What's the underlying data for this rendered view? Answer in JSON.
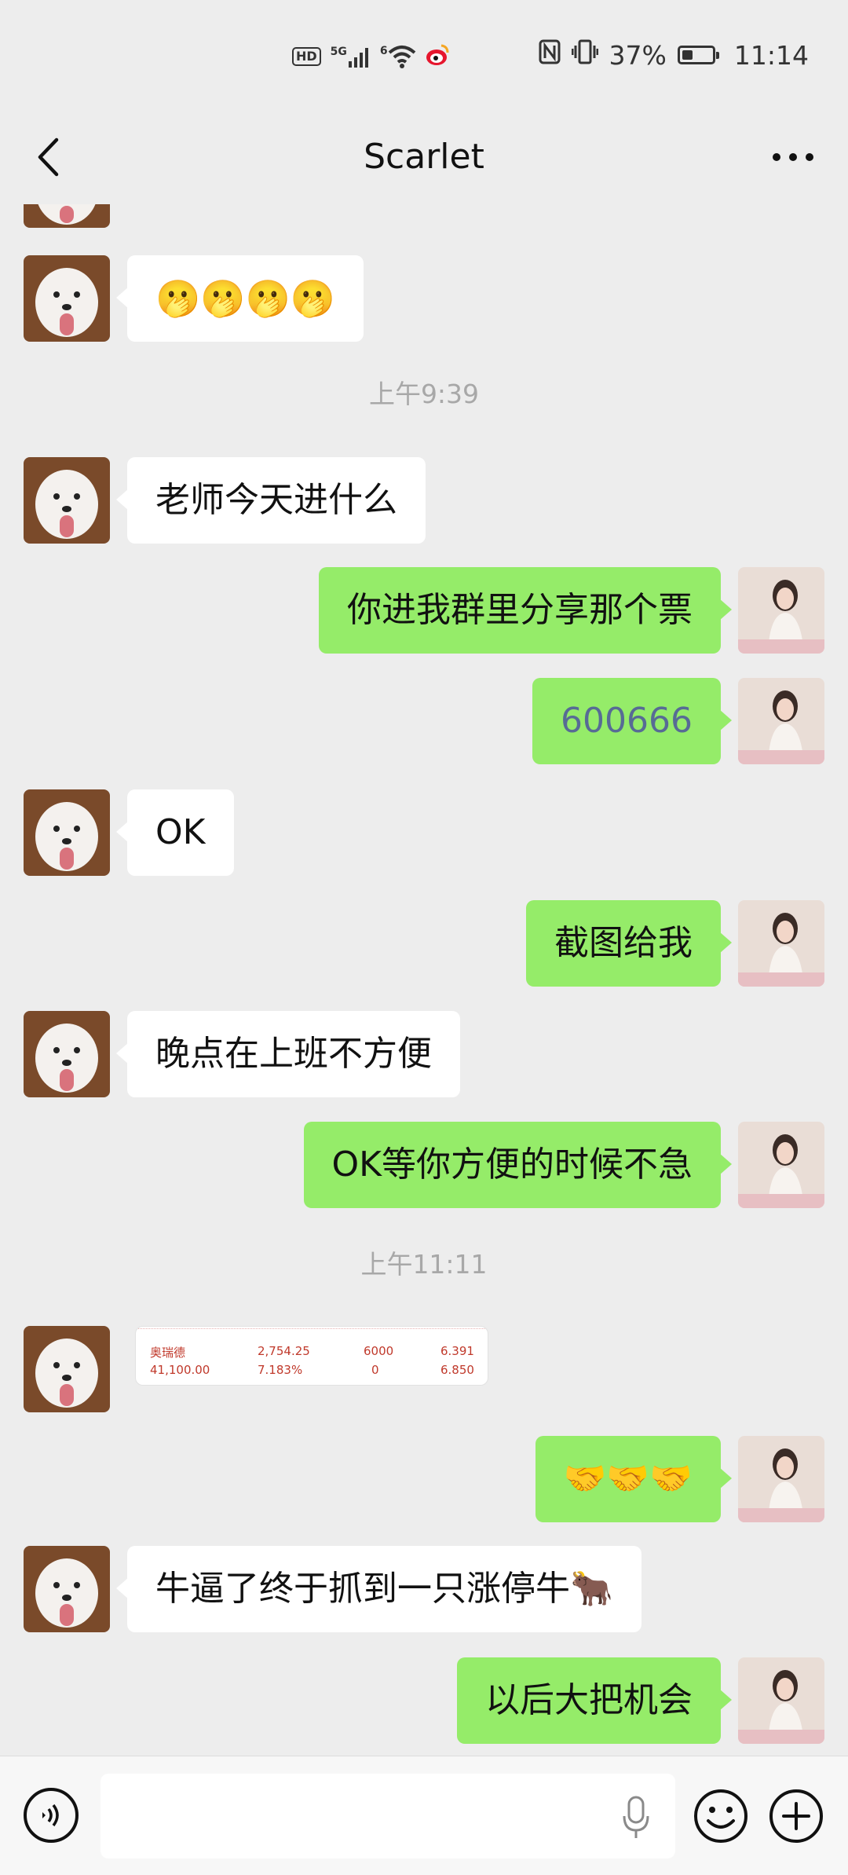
{
  "status_bar": {
    "hd": "HD",
    "net_5g": "5G",
    "wifi_6": "6",
    "battery": "37%",
    "battery_level": 0.37,
    "time": "11:14"
  },
  "nav": {
    "title": "Scarlet"
  },
  "messages": [
    {
      "from": "them",
      "text": "🫢🫢🫢🫢"
    },
    {
      "type": "time",
      "text": "上午9:39"
    },
    {
      "from": "them",
      "text": "老师今天进什么"
    },
    {
      "from": "me",
      "text": "你进我群里分享那个票"
    },
    {
      "from": "me",
      "text": "600666",
      "link": true
    },
    {
      "from": "them",
      "text": "OK"
    },
    {
      "from": "me",
      "text": "截图给我"
    },
    {
      "from": "them",
      "text": "晚点在上班不方便"
    },
    {
      "from": "me",
      "text": "OK等你方便的时候不急"
    },
    {
      "type": "time",
      "text": "上午11:11"
    },
    {
      "from": "them",
      "type": "image",
      "rows": [
        [
          "奥瑞德",
          "2,754.25",
          "6000",
          "6.391"
        ],
        [
          "41,100.00",
          "7.183%",
          "0",
          "6.850"
        ]
      ]
    },
    {
      "from": "me",
      "text": "🤝🤝🤝"
    },
    {
      "from": "them",
      "text": "牛逼了终于抓到一只涨停牛🐂"
    },
    {
      "from": "me",
      "text": "以后大把机会"
    }
  ],
  "input": {
    "value": ""
  },
  "colors": {
    "background": "#ededed",
    "bubble_me": "#95ec69",
    "bubble_them": "#ffffff",
    "link": "#576b95",
    "timestamp": "#a8a8a8"
  }
}
